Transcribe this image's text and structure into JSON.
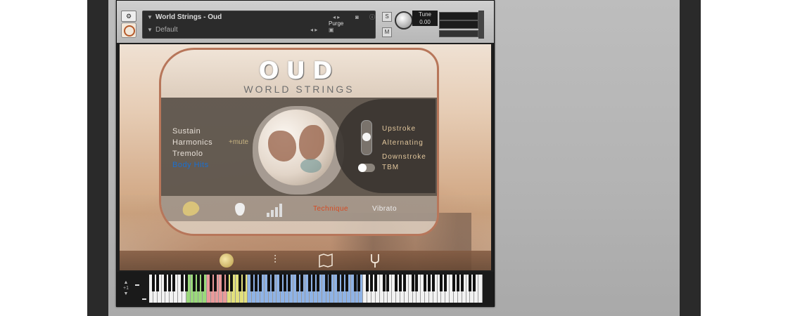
{
  "header": {
    "instrument_name": "World Strings - Oud",
    "preset_name": "Default",
    "purge_label": "Purge",
    "tune_label": "Tune",
    "tune_value": "0.00",
    "solo_label": "S",
    "mute_label": "M"
  },
  "logo": {
    "title": "OUD",
    "subtitle": "WORLD STRINGS"
  },
  "articulations": [
    {
      "label": "Sustain",
      "active": false
    },
    {
      "label": "Harmonics",
      "active": false
    },
    {
      "label": "Tremolo",
      "active": false
    },
    {
      "label": "Body Hits",
      "active": true
    }
  ],
  "mute_option": "+mute",
  "stroke_options": [
    "Upstroke",
    "Alternating",
    "Downstroke"
  ],
  "tbm_label": "TBM",
  "bottom_tabs": {
    "technique": "Technique",
    "vibrato": "Vibrato"
  },
  "colors": {
    "accent_active": "#1a6fd0",
    "technique_active": "#d64a22",
    "panel_border": "#b7765a",
    "gold_text": "#e2c79d"
  },
  "icons": [
    "oud-icon",
    "pick-icon",
    "velocity-bars-icon",
    "globe-icon",
    "mixer-icon",
    "map-icon",
    "tuning-fork-icon"
  ],
  "keyboard": {
    "zones": [
      {
        "name": "green",
        "color": "#9ad97a"
      },
      {
        "name": "red",
        "color": "#e99a9a"
      },
      {
        "name": "yellow",
        "color": "#e2e07c"
      },
      {
        "name": "blue",
        "color": "#8fb3e6"
      }
    ],
    "octave_label": "+1"
  }
}
